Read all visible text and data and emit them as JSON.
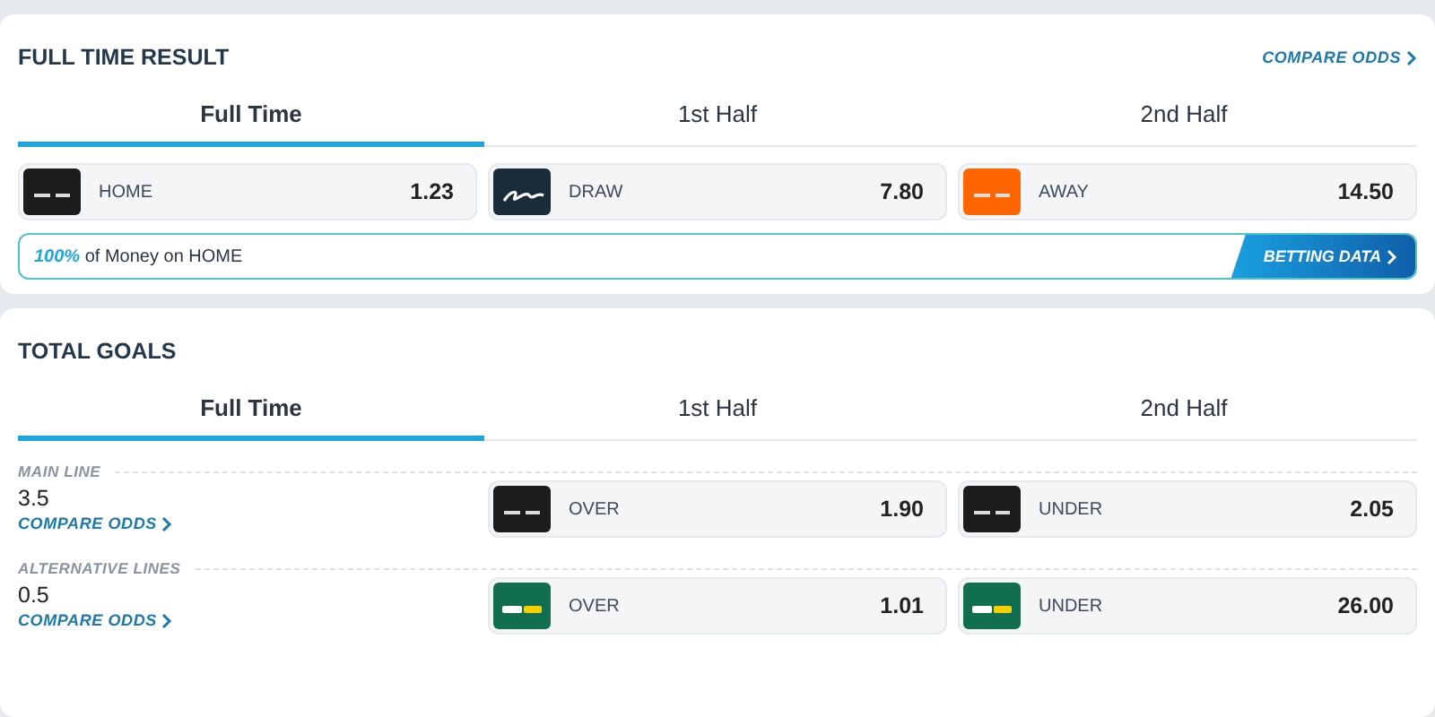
{
  "full_time_result": {
    "title": "FULL TIME RESULT",
    "compare_link": "COMPARE ODDS",
    "tabs": [
      {
        "label": "Full Time",
        "selected": true
      },
      {
        "label": "1st Half",
        "selected": false
      },
      {
        "label": "2nd Half",
        "selected": false
      }
    ],
    "odds": [
      {
        "color": "#1c1c1c",
        "kind": "bars",
        "label": "HOME",
        "price": "1.23"
      },
      {
        "color": "#1a2c38",
        "kind": "script",
        "label": "DRAW",
        "price": "7.80"
      },
      {
        "color": "#ff6600",
        "kind": "bars",
        "label": "AWAY",
        "price": "14.50"
      }
    ],
    "money": {
      "percent": "100%",
      "text": "of Money on HOME",
      "button": "BETTING DATA"
    }
  },
  "total_goals": {
    "title": "TOTAL GOALS",
    "tabs": [
      {
        "label": "Full Time",
        "selected": true
      },
      {
        "label": "1st Half",
        "selected": false
      },
      {
        "label": "2nd Half",
        "selected": false
      }
    ],
    "sections": [
      {
        "heading": "MAIN LINE",
        "line": "3.5",
        "compare_link": "COMPARE ODDS",
        "odds": [
          {
            "color": "#1c1c1c",
            "kind": "bars",
            "label": "OVER",
            "price": "1.90"
          },
          {
            "color": "#1c1c1c",
            "kind": "bars",
            "label": "UNDER",
            "price": "2.05"
          }
        ]
      },
      {
        "heading": "ALTERNATIVE LINES",
        "line": "0.5",
        "compare_link": "COMPARE ODDS",
        "odds": [
          {
            "color": "#126e51",
            "kind": "bars2",
            "label": "OVER",
            "price": "1.01"
          },
          {
            "color": "#126e51",
            "kind": "bars2",
            "label": "UNDER",
            "price": "26.00"
          }
        ]
      }
    ]
  }
}
